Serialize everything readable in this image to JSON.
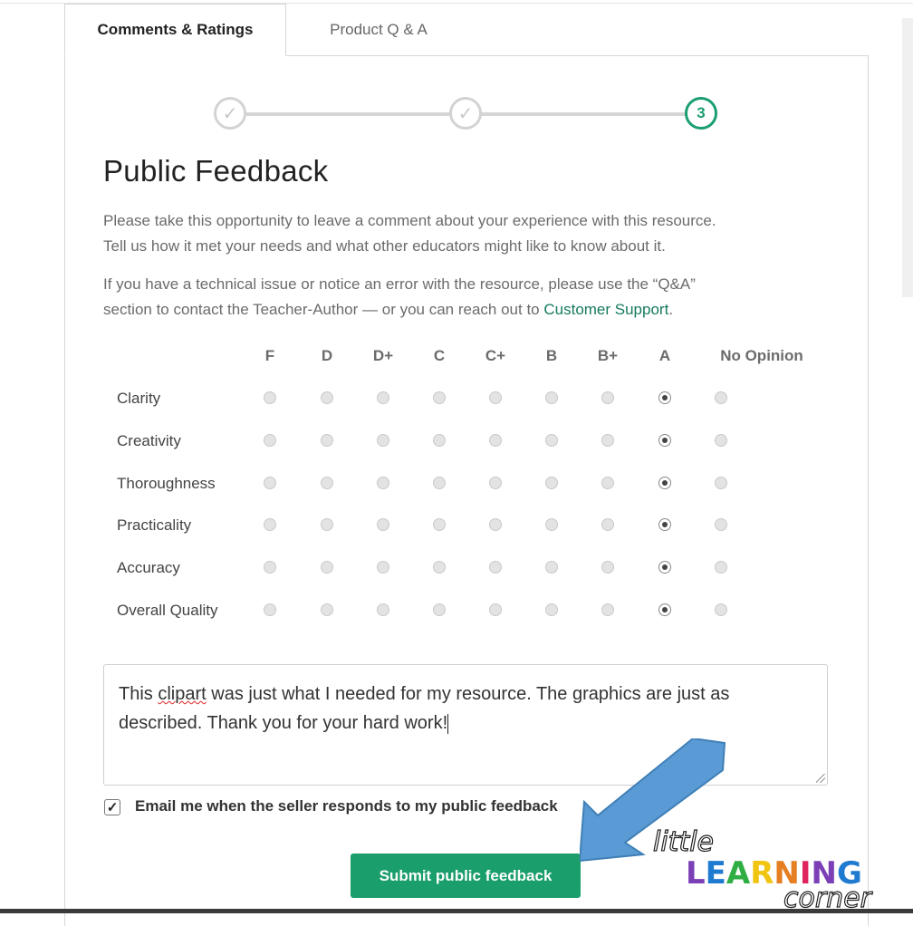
{
  "tabs": {
    "active": "Comments & Ratings",
    "inactive": "Product Q & A"
  },
  "stepper": {
    "step1": "✓",
    "step2": "✓",
    "step3": "3",
    "accent_color": "#1a9e72"
  },
  "section": {
    "title": "Public Feedback",
    "intro_line1": "Please take this opportunity to leave a comment about your experience with this resource.",
    "intro_line2": "Tell us how it met your needs and what other educators might like to know about it.",
    "tech_line1": "If you have a technical issue or notice an error with the resource, please use the “Q&A”",
    "tech_line2_prefix": "section to contact the Teacher-Author — or you can reach out to ",
    "support_link": "Customer Support",
    "tech_line2_suffix": "."
  },
  "ratings": {
    "columns": [
      "F",
      "D",
      "D+",
      "C",
      "C+",
      "B",
      "B+",
      "A",
      "No Opinion"
    ],
    "rows": [
      {
        "label": "Clarity",
        "selected": "A"
      },
      {
        "label": "Creativity",
        "selected": "A"
      },
      {
        "label": "Thoroughness",
        "selected": "A"
      },
      {
        "label": "Practicality",
        "selected": "A"
      },
      {
        "label": "Accuracy",
        "selected": "A"
      },
      {
        "label": "Overall Quality",
        "selected": "A"
      }
    ]
  },
  "comment": {
    "text_part1": "This ",
    "misspelled_word": "clipart",
    "text_part2": " was just what I needed for my resource.  The graphics are just as described.  Thank you for your hard work!"
  },
  "email_option": {
    "checked": true,
    "label": "Email me when the seller responds to my public feedback"
  },
  "submit": {
    "label": "Submit public feedback",
    "color": "#1a9e6b"
  },
  "overlay": {
    "arrow_color": "#5b9bd5",
    "logo_text_top": "little",
    "logo_text_mid": "LEARNING",
    "logo_text_bottom": "corner"
  }
}
